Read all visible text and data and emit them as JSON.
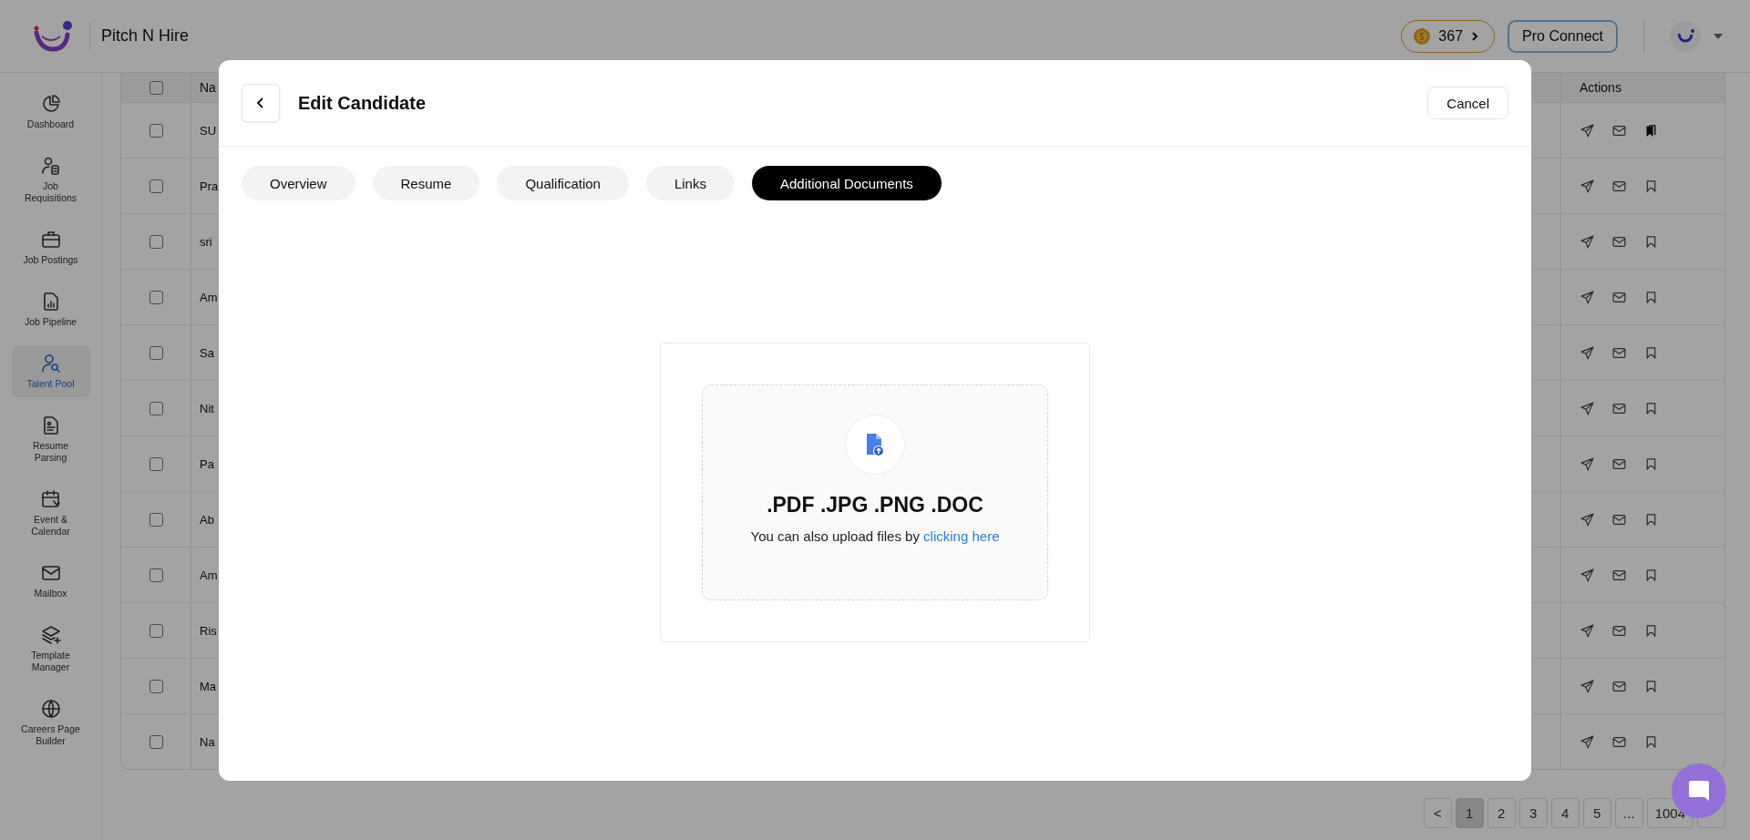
{
  "header": {
    "brand": "Pitch N Hire",
    "coins": "367",
    "pro_button": "Pro Connect"
  },
  "sidebar": {
    "items": [
      {
        "label": "Dashboard",
        "selected": false
      },
      {
        "label": "Job Requisitions",
        "selected": false
      },
      {
        "label": "Job Postings",
        "selected": false
      },
      {
        "label": "Job Pipeline",
        "selected": false
      },
      {
        "label": "Talent Pool",
        "selected": true
      },
      {
        "label": "Resume Parsing",
        "selected": false
      },
      {
        "label": "Event & Calendar",
        "selected": false
      },
      {
        "label": "Mailbox",
        "selected": false
      },
      {
        "label": "Template Manager",
        "selected": false
      },
      {
        "label": "Careers Page Builder",
        "selected": false
      }
    ]
  },
  "table": {
    "columns": [
      "Na",
      "Actions"
    ],
    "all_checked": false,
    "rows": [
      {
        "name": "SU",
        "checked": false,
        "saved": true
      },
      {
        "name": "Pra",
        "checked": false,
        "saved": false
      },
      {
        "name": "sri",
        "checked": false,
        "saved": false
      },
      {
        "name": "Am",
        "checked": false,
        "saved": false
      },
      {
        "name": "Sa",
        "checked": false,
        "saved": false
      },
      {
        "name": "Nit",
        "checked": false,
        "saved": false
      },
      {
        "name": "Pa",
        "checked": false,
        "saved": false
      },
      {
        "name": "Ab",
        "checked": false,
        "saved": false
      },
      {
        "name": "Am",
        "checked": false,
        "saved": false
      },
      {
        "name": "Ris",
        "checked": false,
        "saved": false
      },
      {
        "name": "Ma",
        "checked": false,
        "saved": false
      },
      {
        "name": "Na",
        "checked": false,
        "saved": false
      }
    ]
  },
  "pagination": {
    "prev": "<",
    "pages": [
      {
        "label": "1",
        "selected": true
      },
      {
        "label": "2",
        "selected": false
      },
      {
        "label": "3",
        "selected": false
      },
      {
        "label": "4",
        "selected": false
      },
      {
        "label": "5",
        "selected": false
      },
      {
        "label": "...",
        "selected": false
      },
      {
        "label": "1004",
        "selected": false
      }
    ]
  },
  "modal": {
    "title": "Edit Candidate",
    "cancel": "Cancel",
    "tabs": [
      {
        "label": "Overview",
        "selected": false
      },
      {
        "label": "Resume",
        "selected": false
      },
      {
        "label": "Qualification",
        "selected": false
      },
      {
        "label": "Links",
        "selected": false
      },
      {
        "label": "Additional Documents",
        "selected": true
      }
    ],
    "upload": {
      "formats": ".PDF .JPG .PNG .DOC",
      "hint": "You can also upload files by",
      "link": "clicking here"
    }
  }
}
